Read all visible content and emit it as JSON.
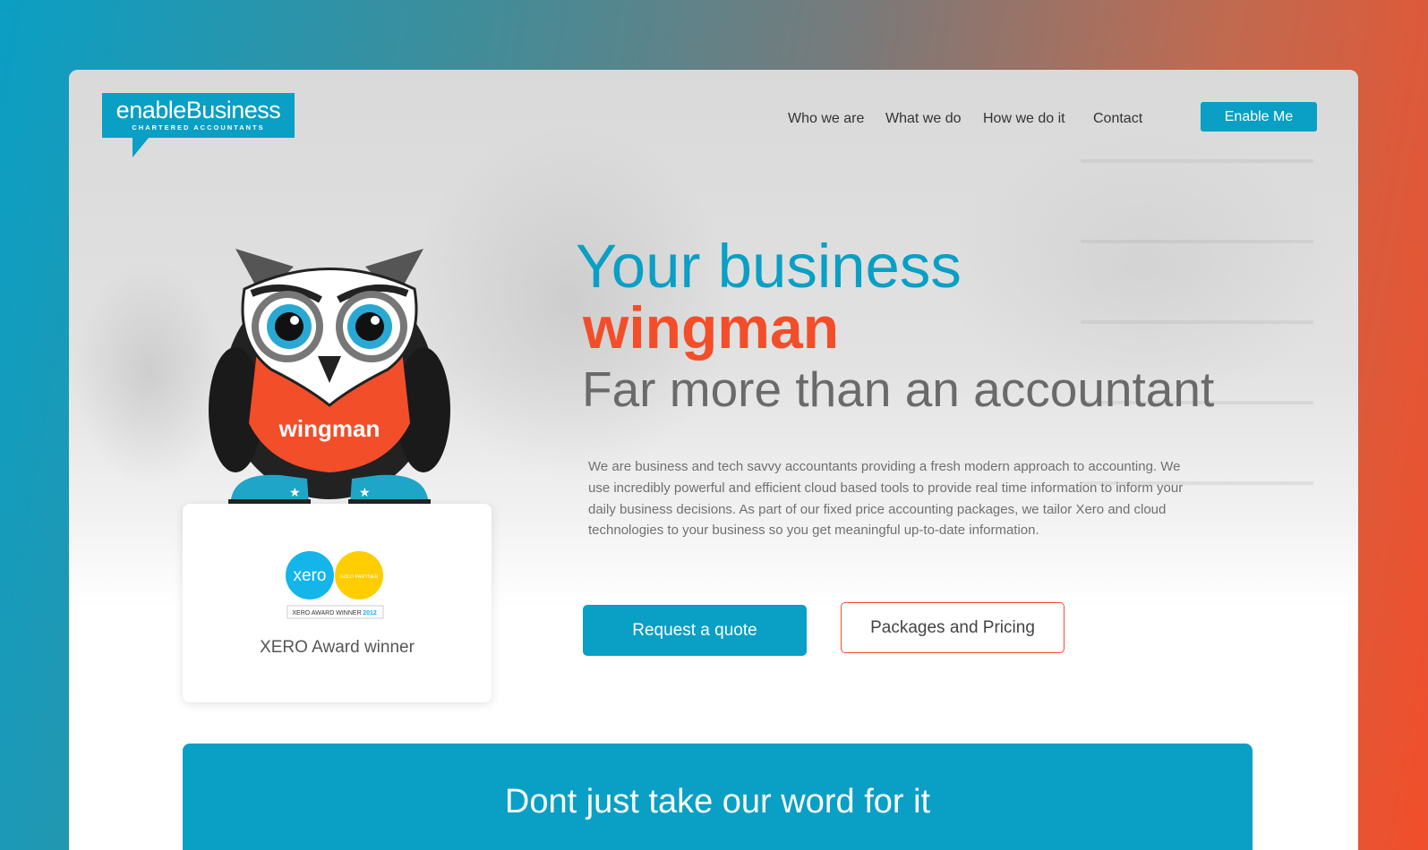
{
  "brand": {
    "name": "enableBusiness",
    "tagline": "CHARTERED ACCOUNTANTS",
    "color_primary": "#0a9fc4",
    "color_accent": "#f24e2a"
  },
  "nav": {
    "items": [
      {
        "label": "Who we are"
      },
      {
        "label": "What we do"
      },
      {
        "label": "How we do it"
      },
      {
        "label": "Contact"
      }
    ],
    "cta_label": "Enable Me"
  },
  "hero": {
    "headline_line1": "Your business",
    "headline_line2": "wingman",
    "headline_line3": "Far more than an accountant",
    "intro": "We are business and tech savvy accountants providing a fresh modern approach to accounting. We use incredibly powerful and efficient cloud based tools to provide real time information to inform your daily business decisions. As part of our fixed price accounting packages, we tailor Xero and cloud technologies to your business so you get meaningful up-to-date information.",
    "quote_button": "Request a quote",
    "pricing_button": "Packages and Pricing",
    "mascot_label": "wingman"
  },
  "award": {
    "xero_logo_text": "xero",
    "badge_text": "GOLD PARTNER",
    "banner_text": "XERO AWARD WINNER",
    "banner_year": "2012",
    "caption": "XERO Award winner"
  },
  "testimonial": {
    "title": "Dont just take our word for it"
  }
}
